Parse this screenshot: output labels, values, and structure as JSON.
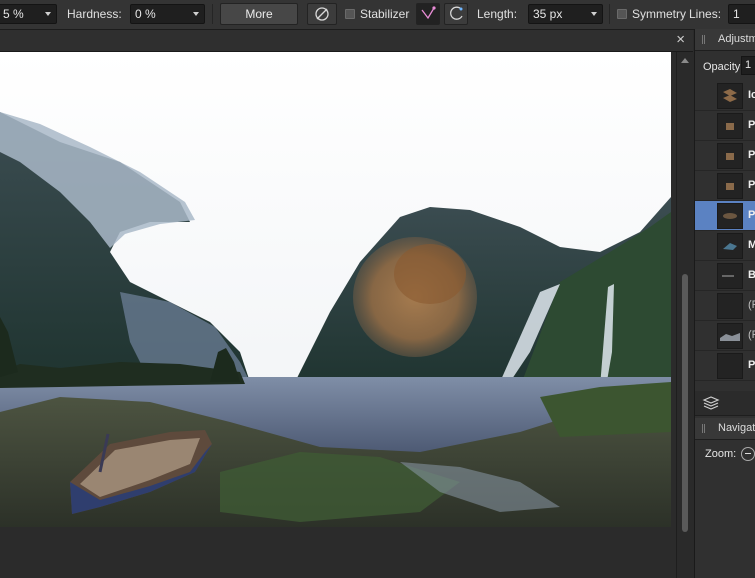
{
  "toolbar": {
    "width_value": "5 %",
    "hardness_label": "Hardness:",
    "hardness_value": "0 %",
    "more_label": "More",
    "stabilizer_label": "Stabilizer",
    "length_label": "Length:",
    "length_value": "35 px",
    "symmetry_label": "Symmetry",
    "lines_label": "Lines:",
    "lines_value": "1"
  },
  "document": {
    "close_glyph": "×"
  },
  "panels": {
    "adjustments_title": "Adjustm",
    "opacity_label": "Opacity:",
    "opacity_value": "1",
    "layers": [
      {
        "name": "Ic",
        "thumb": "brush-strokes",
        "selected": false,
        "bold": true
      },
      {
        "name": "P",
        "thumb": "rock-texture",
        "selected": false,
        "bold": true
      },
      {
        "name": "P",
        "thumb": "rock-texture",
        "selected": false,
        "bold": true
      },
      {
        "name": "P",
        "thumb": "rock-texture",
        "selected": false,
        "bold": true
      },
      {
        "name": "P",
        "thumb": "brown-patch",
        "selected": true,
        "bold": true
      },
      {
        "name": "M",
        "thumb": "mask-swatch",
        "selected": false,
        "bold": true
      },
      {
        "name": "B",
        "thumb": "line-thumb",
        "selected": false,
        "bold": true
      },
      {
        "name": "(F",
        "thumb": "empty",
        "selected": false,
        "bold": false
      },
      {
        "name": "(F",
        "thumb": "cloud-thumb",
        "selected": false,
        "bold": false
      },
      {
        "name": "P",
        "thumb": "empty",
        "selected": false,
        "bold": true
      }
    ],
    "navigator_title": "Navigat",
    "zoom_label": "Zoom:"
  },
  "colors": {
    "selection": "#5b82c2",
    "toolbar_bg": "#343434",
    "panel_bg": "#303030"
  }
}
